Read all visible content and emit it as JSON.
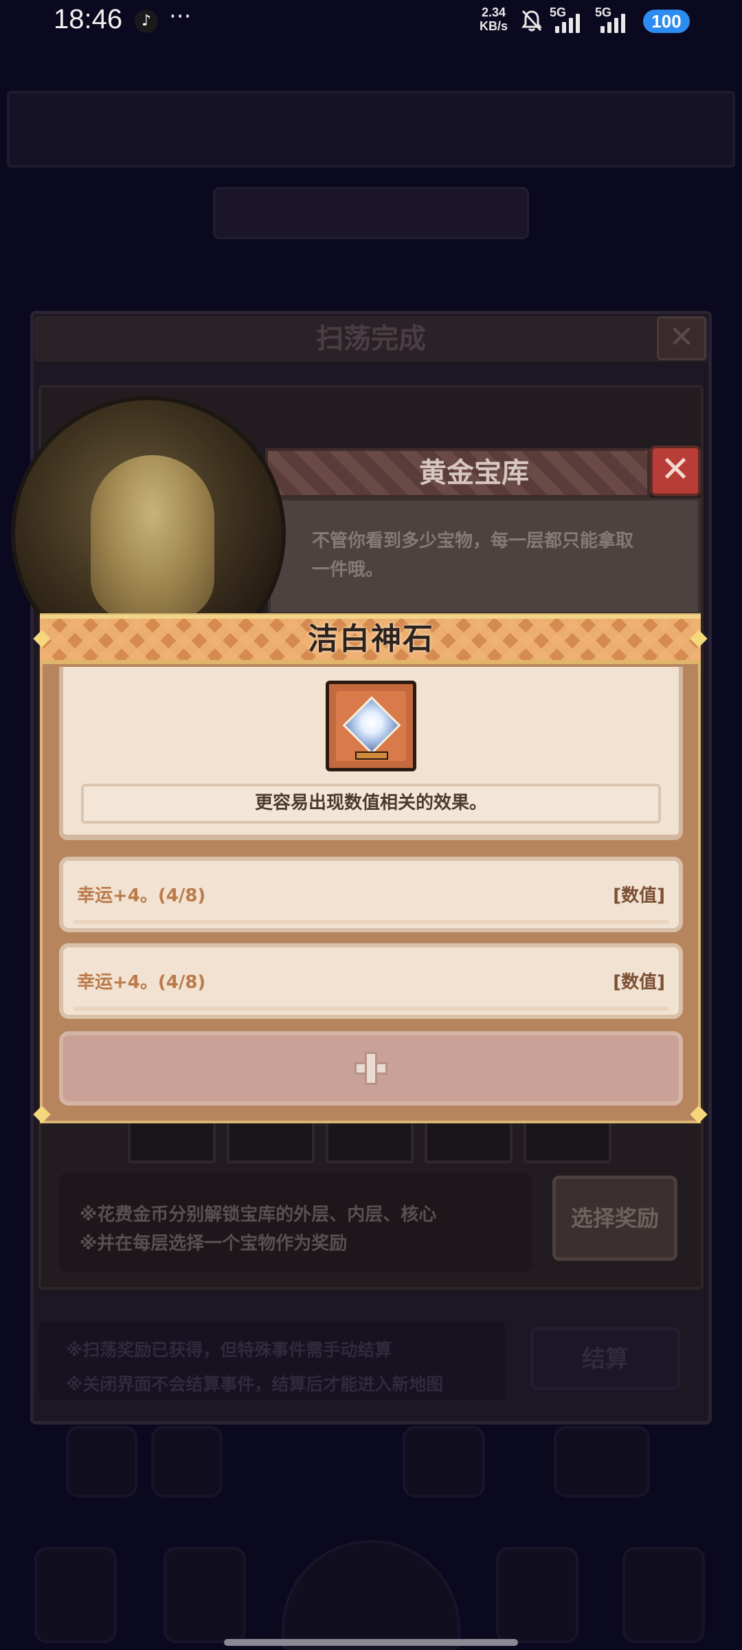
{
  "status_bar": {
    "time": "18:46",
    "app_icon": "tiktok-icon",
    "more": "···",
    "net_speed_value": "2.34",
    "net_speed_unit": "KB/s",
    "signal1_label": "5G",
    "signal2_label": "5G",
    "battery": "100"
  },
  "background": {
    "dialog_title": "扫荡完成",
    "notes": [
      "※花费金币分别解锁宝库的外层、内层、核心",
      "※并在每层选择一个宝物作为奖励"
    ],
    "choose_reward_button": "选择奖励",
    "bottom_notes": [
      "※扫荡奖励已获得，但特殊事件需手动结算",
      "※关闭界面不会结算事件，结算后才能进入新地图"
    ],
    "settle_button": "结算"
  },
  "treasury": {
    "title": "黄金宝库",
    "description": "不管你看到多少宝物，每一层都只能拿取一件哦。"
  },
  "item": {
    "name": "洁白神石",
    "icon": "white-gem-icon",
    "description": "更容易出现数值相关的效果。",
    "effects": [
      {
        "text": "幸运+4。(4/8)",
        "tag": "[数值]"
      },
      {
        "text": "幸运+4。(4/8)",
        "tag": "[数值]"
      }
    ],
    "add_slot_icon": "plus-icon"
  },
  "colors": {
    "card_header": "#d58a4e",
    "card_body": "#f1e2d2",
    "effect_text": "#bb7a4a",
    "close_red": "#b93d37",
    "background": "#0b0920"
  }
}
